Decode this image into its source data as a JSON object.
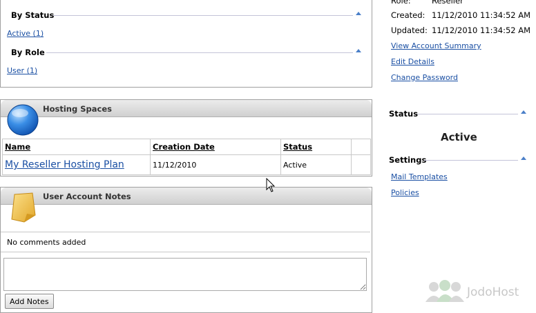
{
  "filters": {
    "by_status_title": "By Status",
    "active_link": "Active (1)",
    "by_role_title": "By Role",
    "user_link": "User (1)"
  },
  "hosting_spaces": {
    "title": "Hosting Spaces",
    "columns": [
      "Name",
      "Creation Date",
      "Status",
      ""
    ],
    "rows": [
      {
        "name": "My Reseller Hosting Plan",
        "date": "11/12/2010",
        "status": "Active"
      }
    ]
  },
  "notes": {
    "title": "User Account Notes",
    "empty_text": "No comments added",
    "textarea_value": "",
    "add_button": "Add Notes"
  },
  "account": {
    "role_label": "Role:",
    "role_value": "Reseller",
    "created_label": "Created:",
    "created_value": "11/12/2010 11:34:52 AM",
    "updated_label": "Updated:",
    "updated_value": "11/12/2010 11:34:52 AM",
    "links": [
      "View Account Summary",
      "Edit Details",
      "Change Password"
    ]
  },
  "status": {
    "title": "Status",
    "value": "Active"
  },
  "settings": {
    "title": "Settings",
    "links": [
      "Mail Templates",
      "Policies"
    ]
  },
  "watermark": {
    "text": "JodoHost"
  },
  "colors": {
    "link": "#1a4fa3",
    "accent_arrow": "#4a7fc8",
    "panel_border": "#a0a0a0"
  }
}
